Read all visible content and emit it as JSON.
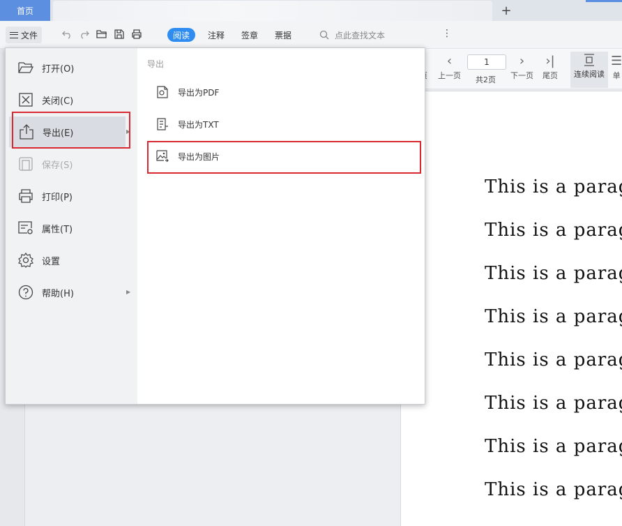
{
  "tabs": {
    "home": "首页",
    "add": "+"
  },
  "toolbar": {
    "file_label": "文件",
    "modes": [
      "阅读",
      "注释",
      "签章",
      "票据"
    ],
    "active_mode": "阅读",
    "search_placeholder": "点此查找文本",
    "more": "⋮"
  },
  "nav": {
    "page_value": "1",
    "total": "共2页",
    "prev_cut": "页",
    "prev": "上一页",
    "next": "下一页",
    "last": "尾页",
    "continuous": "连续阅读",
    "single_cut": "单"
  },
  "menu": {
    "items": [
      {
        "label": "打开(O)",
        "icon": "folder-open-icon",
        "state": "normal"
      },
      {
        "label": "关闭(C)",
        "icon": "close-box-icon",
        "state": "normal"
      },
      {
        "label": "导出(E)",
        "icon": "export-icon",
        "state": "selected",
        "submenu": true
      },
      {
        "label": "保存(S)",
        "icon": "save-icon",
        "state": "disabled"
      },
      {
        "label": "打印(P)",
        "icon": "printer-icon",
        "state": "normal"
      },
      {
        "label": "属性(T)",
        "icon": "properties-icon",
        "state": "normal"
      },
      {
        "label": "设置",
        "icon": "gear-icon",
        "state": "normal"
      },
      {
        "label": "帮助(H)",
        "icon": "help-icon",
        "state": "normal",
        "submenu": true
      }
    ],
    "submenu_title": "导出",
    "submenu_items": [
      {
        "label": "导出为PDF",
        "icon": "export-pdf-icon"
      },
      {
        "label": "导出为TXT",
        "icon": "export-txt-icon"
      },
      {
        "label": "导出为图片",
        "icon": "export-image-icon",
        "highlighted": true
      }
    ]
  },
  "document": {
    "paragraphs": [
      "This is a parag",
      "This is a parag",
      "This is a parag",
      "This is a parag",
      "This is a parag",
      "This is a parag",
      "This is a parag",
      "This is a parag"
    ]
  },
  "colors": {
    "accent": "#2f8cf0",
    "home_tab": "#5c8fe0",
    "highlight_box": "#d9282f"
  }
}
